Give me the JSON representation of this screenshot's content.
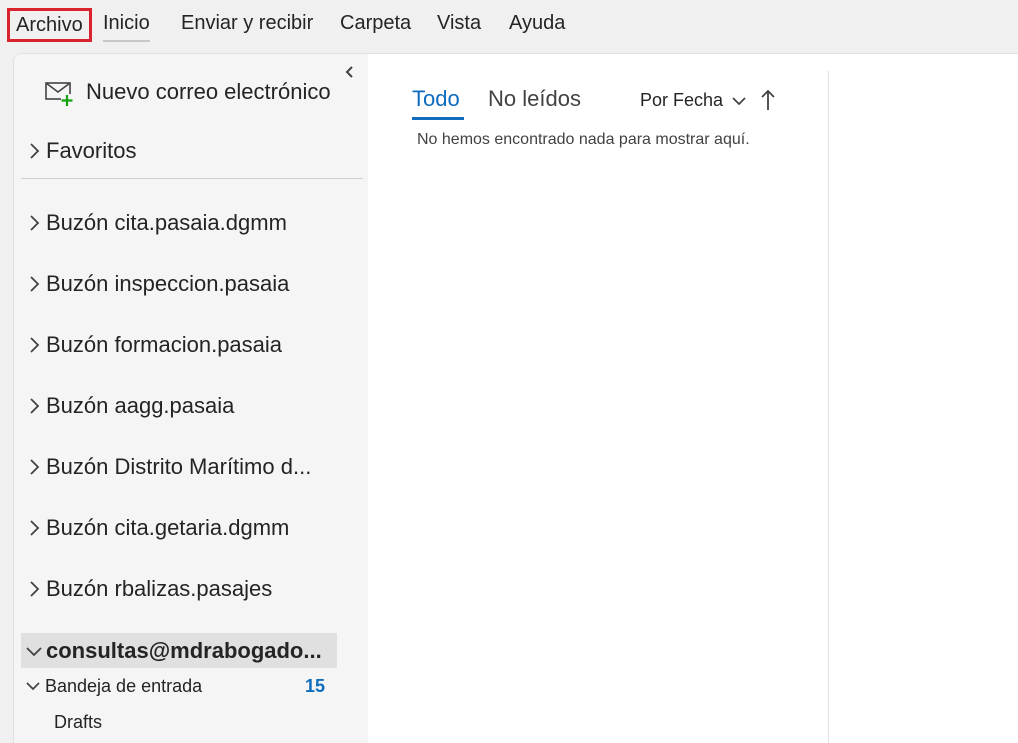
{
  "menubar": {
    "items": [
      "Archivo",
      "Inicio",
      "Enviar y recibir",
      "Carpeta",
      "Vista",
      "Ayuda"
    ]
  },
  "folder_pane": {
    "new_mail_label": "Nuevo correo electrónico",
    "favorites_label": "Favoritos",
    "mailboxes": [
      "Buzón cita.pasaia.dgmm",
      "Buzón inspeccion.pasaia",
      "Buzón formacion.pasaia",
      "Buzón aagg.pasaia",
      "Buzón Distrito Marítimo d...",
      "Buzón cita.getaria.dgmm",
      "Buzón rbalizas.pasajes"
    ],
    "account_label": "consultas@mdrabogado...",
    "inbox_label": "Bandeja de entrada",
    "inbox_count": "15",
    "drafts_label": "Drafts"
  },
  "message_list": {
    "tabs": [
      "Todo",
      "No leídos"
    ],
    "sort_label": "Por Fecha",
    "empty_message": "No hemos encontrado nada para mostrar aquí."
  },
  "colors": {
    "accent": "#0f6cbd",
    "highlight_border": "#d9232e",
    "pane_bg": "#f5f5f5",
    "selected_bg": "#e0e0e0",
    "new_mail_plus": "#13a10e"
  },
  "icons": [
    "mail-new-icon",
    "chevron-right-icon",
    "chevron-down-icon",
    "collapse-pane-icon",
    "sort-arrow-up-icon"
  ]
}
